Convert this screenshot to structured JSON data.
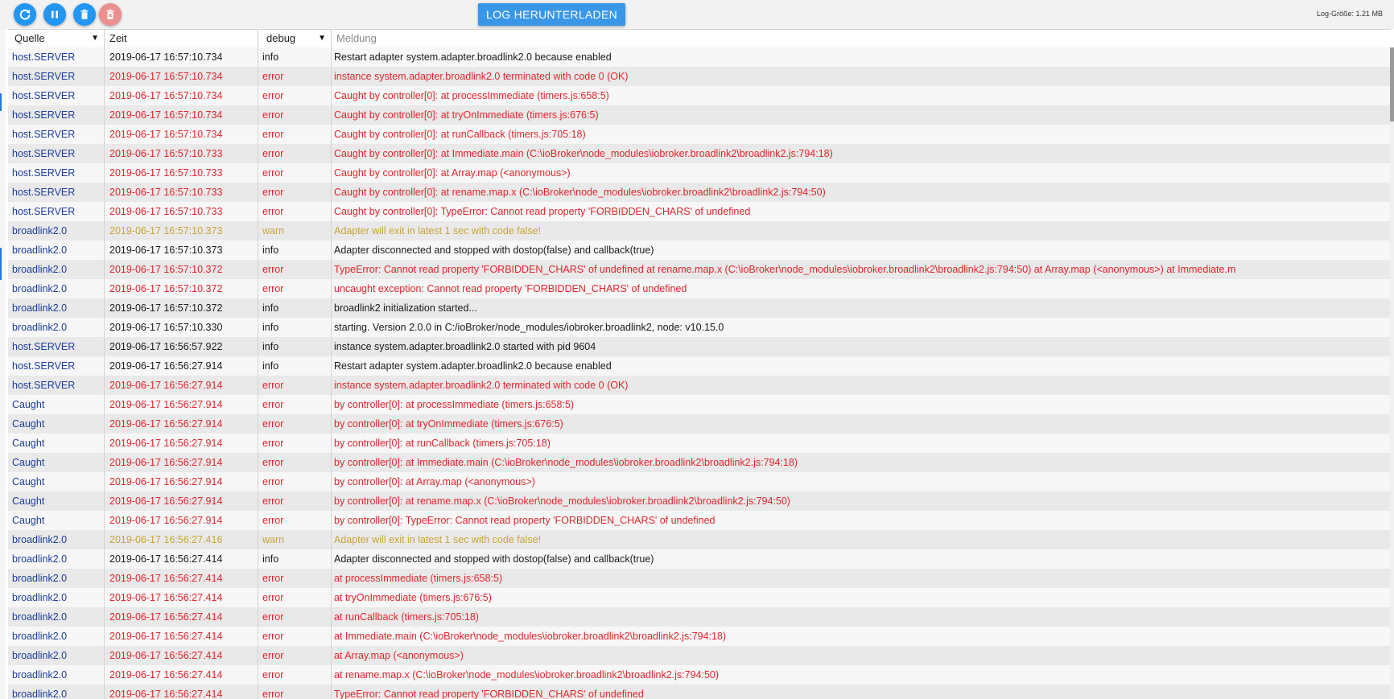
{
  "toolbar": {
    "refresh_color": "#2196f3",
    "pause_color": "#2196f3",
    "delete_color": "#2196f3",
    "delete_all_color": "#ec8f8f",
    "download_label": "LOG HERUNTERLADEN",
    "log_size": "Log-Größe: 1.21 MB"
  },
  "filters": {
    "source": "Quelle",
    "time": "Zeit",
    "level": "debug",
    "message_placeholder": "Meldung"
  },
  "colors": {
    "info": "#1b1b1b",
    "error": "#e0262b",
    "warn": "#c9a437",
    "source": "#1d3f9a"
  },
  "rows": [
    {
      "src": "host.SERVER",
      "time": "2019-06-17 16:57:10.734",
      "sev": "info",
      "msg": "Restart adapter system.adapter.broadlink2.0 because enabled"
    },
    {
      "src": "host.SERVER",
      "time": "2019-06-17 16:57:10.734",
      "sev": "error",
      "msg": "instance system.adapter.broadlink2.0 terminated with code 0 (OK)"
    },
    {
      "src": "host.SERVER",
      "time": "2019-06-17 16:57:10.734",
      "sev": "error",
      "msg": "Caught by controller[0]: at processImmediate (timers.js:658:5)"
    },
    {
      "src": "host.SERVER",
      "time": "2019-06-17 16:57:10.734",
      "sev": "error",
      "msg": "Caught by controller[0]: at tryOnImmediate (timers.js:676:5)"
    },
    {
      "src": "host.SERVER",
      "time": "2019-06-17 16:57:10.734",
      "sev": "error",
      "msg": "Caught by controller[0]: at runCallback (timers.js:705:18)"
    },
    {
      "src": "host.SERVER",
      "time": "2019-06-17 16:57:10.733",
      "sev": "error",
      "msg": "Caught by controller[0]: at Immediate.main (C:\\ioBroker\\node_modules\\iobroker.broadlink2\\broadlink2.js:794:18)"
    },
    {
      "src": "host.SERVER",
      "time": "2019-06-17 16:57:10.733",
      "sev": "error",
      "msg": "Caught by controller[0]: at Array.map (<anonymous>)"
    },
    {
      "src": "host.SERVER",
      "time": "2019-06-17 16:57:10.733",
      "sev": "error",
      "msg": "Caught by controller[0]: at rename.map.x (C:\\ioBroker\\node_modules\\iobroker.broadlink2\\broadlink2.js:794:50)"
    },
    {
      "src": "host.SERVER",
      "time": "2019-06-17 16:57:10.733",
      "sev": "error",
      "msg": "Caught by controller[0]: TypeError: Cannot read property 'FORBIDDEN_CHARS' of undefined"
    },
    {
      "src": "broadlink2.0",
      "time": "2019-06-17 16:57:10.373",
      "sev": "warn",
      "msg": "Adapter will exit in latest 1 sec with code false!"
    },
    {
      "src": "broadlink2.0",
      "time": "2019-06-17 16:57:10.373",
      "sev": "info",
      "msg": "Adapter disconnected and stopped with dostop(false) and callback(true)"
    },
    {
      "src": "broadlink2.0",
      "time": "2019-06-17 16:57:10.372",
      "sev": "error",
      "msg": "TypeError: Cannot read property 'FORBIDDEN_CHARS' of undefined at rename.map.x (C:\\ioBroker\\node_modules\\iobroker.broadlink2\\broadlink2.js:794:50) at Array.map (<anonymous>) at Immediate.m"
    },
    {
      "src": "broadlink2.0",
      "time": "2019-06-17 16:57:10.372",
      "sev": "error",
      "msg": "uncaught exception: Cannot read property 'FORBIDDEN_CHARS' of undefined"
    },
    {
      "src": "broadlink2.0",
      "time": "2019-06-17 16:57:10.372",
      "sev": "info",
      "msg": "broadlink2 initialization started..."
    },
    {
      "src": "broadlink2.0",
      "time": "2019-06-17 16:57:10.330",
      "sev": "info",
      "msg": "starting. Version 2.0.0 in C:/ioBroker/node_modules/iobroker.broadlink2, node: v10.15.0"
    },
    {
      "src": "host.SERVER",
      "time": "2019-06-17 16:56:57.922",
      "sev": "info",
      "msg": "instance system.adapter.broadlink2.0 started with pid 9604"
    },
    {
      "src": "host.SERVER",
      "time": "2019-06-17 16:56:27.914",
      "sev": "info",
      "msg": "Restart adapter system.adapter.broadlink2.0 because enabled"
    },
    {
      "src": "host.SERVER",
      "time": "2019-06-17 16:56:27.914",
      "sev": "error",
      "msg": "instance system.adapter.broadlink2.0 terminated with code 0 (OK)"
    },
    {
      "src": "Caught",
      "time": "2019-06-17 16:56:27.914",
      "sev": "error",
      "msg": "by controller[0]: at processImmediate (timers.js:658:5)"
    },
    {
      "src": "Caught",
      "time": "2019-06-17 16:56:27.914",
      "sev": "error",
      "msg": "by controller[0]: at tryOnImmediate (timers.js:676:5)"
    },
    {
      "src": "Caught",
      "time": "2019-06-17 16:56:27.914",
      "sev": "error",
      "msg": "by controller[0]: at runCallback (timers.js:705:18)"
    },
    {
      "src": "Caught",
      "time": "2019-06-17 16:56:27.914",
      "sev": "error",
      "msg": "by controller[0]: at Immediate.main (C:\\ioBroker\\node_modules\\iobroker.broadlink2\\broadlink2.js:794:18)"
    },
    {
      "src": "Caught",
      "time": "2019-06-17 16:56:27.914",
      "sev": "error",
      "msg": "by controller[0]: at Array.map (<anonymous>)"
    },
    {
      "src": "Caught",
      "time": "2019-06-17 16:56:27.914",
      "sev": "error",
      "msg": "by controller[0]: at rename.map.x (C:\\ioBroker\\node_modules\\iobroker.broadlink2\\broadlink2.js:794:50)"
    },
    {
      "src": "Caught",
      "time": "2019-06-17 16:56:27.914",
      "sev": "error",
      "msg": "by controller[0]: TypeError: Cannot read property 'FORBIDDEN_CHARS' of undefined"
    },
    {
      "src": "broadlink2.0",
      "time": "2019-06-17 16:56:27.416",
      "sev": "warn",
      "msg": "Adapter will exit in latest 1 sec with code false!"
    },
    {
      "src": "broadlink2.0",
      "time": "2019-06-17 16:56:27.414",
      "sev": "info",
      "msg": "Adapter disconnected and stopped with dostop(false) and callback(true)"
    },
    {
      "src": "broadlink2.0",
      "time": "2019-06-17 16:56:27.414",
      "sev": "error",
      "msg": "at processImmediate (timers.js:658:5)"
    },
    {
      "src": "broadlink2.0",
      "time": "2019-06-17 16:56:27.414",
      "sev": "error",
      "msg": "at tryOnImmediate (timers.js:676:5)"
    },
    {
      "src": "broadlink2.0",
      "time": "2019-06-17 16:56:27.414",
      "sev": "error",
      "msg": "at runCallback (timers.js:705:18)"
    },
    {
      "src": "broadlink2.0",
      "time": "2019-06-17 16:56:27.414",
      "sev": "error",
      "msg": "at Immediate.main (C:\\ioBroker\\node_modules\\iobroker.broadlink2\\broadlink2.js:794:18)"
    },
    {
      "src": "broadlink2.0",
      "time": "2019-06-17 16:56:27.414",
      "sev": "error",
      "msg": "at Array.map (<anonymous>)"
    },
    {
      "src": "broadlink2.0",
      "time": "2019-06-17 16:56:27.414",
      "sev": "error",
      "msg": "at rename.map.x (C:\\ioBroker\\node_modules\\iobroker.broadlink2\\broadlink2.js:794:50)"
    },
    {
      "src": "broadlink2.0",
      "time": "2019-06-17 16:56:27.414",
      "sev": "error",
      "msg": "TypeError: Cannot read property 'FORBIDDEN_CHARS' of undefined"
    }
  ]
}
